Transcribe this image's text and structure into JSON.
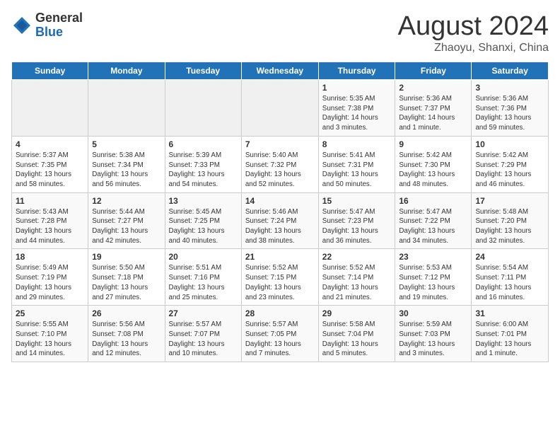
{
  "header": {
    "logo_general": "General",
    "logo_blue": "Blue",
    "month": "August 2024",
    "location": "Zhaoyu, Shanxi, China"
  },
  "days_of_week": [
    "Sunday",
    "Monday",
    "Tuesday",
    "Wednesday",
    "Thursday",
    "Friday",
    "Saturday"
  ],
  "weeks": [
    [
      {
        "day": "",
        "info": ""
      },
      {
        "day": "",
        "info": ""
      },
      {
        "day": "",
        "info": ""
      },
      {
        "day": "",
        "info": ""
      },
      {
        "day": "1",
        "info": "Sunrise: 5:35 AM\nSunset: 7:38 PM\nDaylight: 14 hours\nand 3 minutes."
      },
      {
        "day": "2",
        "info": "Sunrise: 5:36 AM\nSunset: 7:37 PM\nDaylight: 14 hours\nand 1 minute."
      },
      {
        "day": "3",
        "info": "Sunrise: 5:36 AM\nSunset: 7:36 PM\nDaylight: 13 hours\nand 59 minutes."
      }
    ],
    [
      {
        "day": "4",
        "info": "Sunrise: 5:37 AM\nSunset: 7:35 PM\nDaylight: 13 hours\nand 58 minutes."
      },
      {
        "day": "5",
        "info": "Sunrise: 5:38 AM\nSunset: 7:34 PM\nDaylight: 13 hours\nand 56 minutes."
      },
      {
        "day": "6",
        "info": "Sunrise: 5:39 AM\nSunset: 7:33 PM\nDaylight: 13 hours\nand 54 minutes."
      },
      {
        "day": "7",
        "info": "Sunrise: 5:40 AM\nSunset: 7:32 PM\nDaylight: 13 hours\nand 52 minutes."
      },
      {
        "day": "8",
        "info": "Sunrise: 5:41 AM\nSunset: 7:31 PM\nDaylight: 13 hours\nand 50 minutes."
      },
      {
        "day": "9",
        "info": "Sunrise: 5:42 AM\nSunset: 7:30 PM\nDaylight: 13 hours\nand 48 minutes."
      },
      {
        "day": "10",
        "info": "Sunrise: 5:42 AM\nSunset: 7:29 PM\nDaylight: 13 hours\nand 46 minutes."
      }
    ],
    [
      {
        "day": "11",
        "info": "Sunrise: 5:43 AM\nSunset: 7:28 PM\nDaylight: 13 hours\nand 44 minutes."
      },
      {
        "day": "12",
        "info": "Sunrise: 5:44 AM\nSunset: 7:27 PM\nDaylight: 13 hours\nand 42 minutes."
      },
      {
        "day": "13",
        "info": "Sunrise: 5:45 AM\nSunset: 7:25 PM\nDaylight: 13 hours\nand 40 minutes."
      },
      {
        "day": "14",
        "info": "Sunrise: 5:46 AM\nSunset: 7:24 PM\nDaylight: 13 hours\nand 38 minutes."
      },
      {
        "day": "15",
        "info": "Sunrise: 5:47 AM\nSunset: 7:23 PM\nDaylight: 13 hours\nand 36 minutes."
      },
      {
        "day": "16",
        "info": "Sunrise: 5:47 AM\nSunset: 7:22 PM\nDaylight: 13 hours\nand 34 minutes."
      },
      {
        "day": "17",
        "info": "Sunrise: 5:48 AM\nSunset: 7:20 PM\nDaylight: 13 hours\nand 32 minutes."
      }
    ],
    [
      {
        "day": "18",
        "info": "Sunrise: 5:49 AM\nSunset: 7:19 PM\nDaylight: 13 hours\nand 29 minutes."
      },
      {
        "day": "19",
        "info": "Sunrise: 5:50 AM\nSunset: 7:18 PM\nDaylight: 13 hours\nand 27 minutes."
      },
      {
        "day": "20",
        "info": "Sunrise: 5:51 AM\nSunset: 7:16 PM\nDaylight: 13 hours\nand 25 minutes."
      },
      {
        "day": "21",
        "info": "Sunrise: 5:52 AM\nSunset: 7:15 PM\nDaylight: 13 hours\nand 23 minutes."
      },
      {
        "day": "22",
        "info": "Sunrise: 5:52 AM\nSunset: 7:14 PM\nDaylight: 13 hours\nand 21 minutes."
      },
      {
        "day": "23",
        "info": "Sunrise: 5:53 AM\nSunset: 7:12 PM\nDaylight: 13 hours\nand 19 minutes."
      },
      {
        "day": "24",
        "info": "Sunrise: 5:54 AM\nSunset: 7:11 PM\nDaylight: 13 hours\nand 16 minutes."
      }
    ],
    [
      {
        "day": "25",
        "info": "Sunrise: 5:55 AM\nSunset: 7:10 PM\nDaylight: 13 hours\nand 14 minutes."
      },
      {
        "day": "26",
        "info": "Sunrise: 5:56 AM\nSunset: 7:08 PM\nDaylight: 13 hours\nand 12 minutes."
      },
      {
        "day": "27",
        "info": "Sunrise: 5:57 AM\nSunset: 7:07 PM\nDaylight: 13 hours\nand 10 minutes."
      },
      {
        "day": "28",
        "info": "Sunrise: 5:57 AM\nSunset: 7:05 PM\nDaylight: 13 hours\nand 7 minutes."
      },
      {
        "day": "29",
        "info": "Sunrise: 5:58 AM\nSunset: 7:04 PM\nDaylight: 13 hours\nand 5 minutes."
      },
      {
        "day": "30",
        "info": "Sunrise: 5:59 AM\nSunset: 7:03 PM\nDaylight: 13 hours\nand 3 minutes."
      },
      {
        "day": "31",
        "info": "Sunrise: 6:00 AM\nSunset: 7:01 PM\nDaylight: 13 hours\nand 1 minute."
      }
    ]
  ]
}
